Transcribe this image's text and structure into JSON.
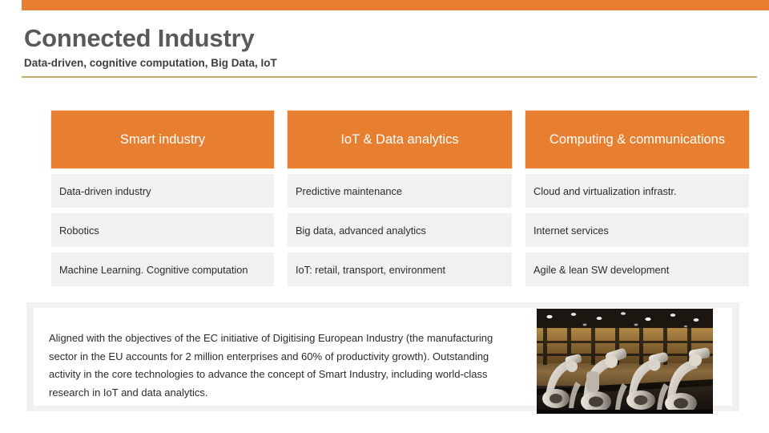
{
  "header": {
    "title": "Connected Industry",
    "subtitle": "Data-driven, cognitive computation, Big Data, IoT",
    "accent_color": "#e87f30",
    "rule_color": "#c9a96a"
  },
  "table": {
    "columns": [
      {
        "header": "Smart industry",
        "items": [
          "Data-driven industry",
          "Robotics",
          "Machine Learning. Cognitive computation"
        ]
      },
      {
        "header": "IoT & Data analytics",
        "items": [
          "Predictive maintenance",
          "Big data, advanced analytics",
          "IoT: retail, transport, environment"
        ]
      },
      {
        "header": "Computing & communications",
        "items": [
          "Cloud and virtualization infrastr.",
          "Internet services",
          "Agile & lean SW development"
        ]
      }
    ],
    "header_bg": "#e87f30",
    "cell_bg": "#f1f1f1"
  },
  "summary": {
    "text": "Aligned with the objectives of the EC initiative of Digitising European Industry (the manufacturing sector in the EU accounts for 2 million enterprises and 60% of productivity growth). Outstanding activity in the core technologies to advance the concept of Smart Industry, including world-class research in IoT and data analytics."
  },
  "photo": {
    "alt": "industrial-robot-arms-in-factory-hall"
  }
}
